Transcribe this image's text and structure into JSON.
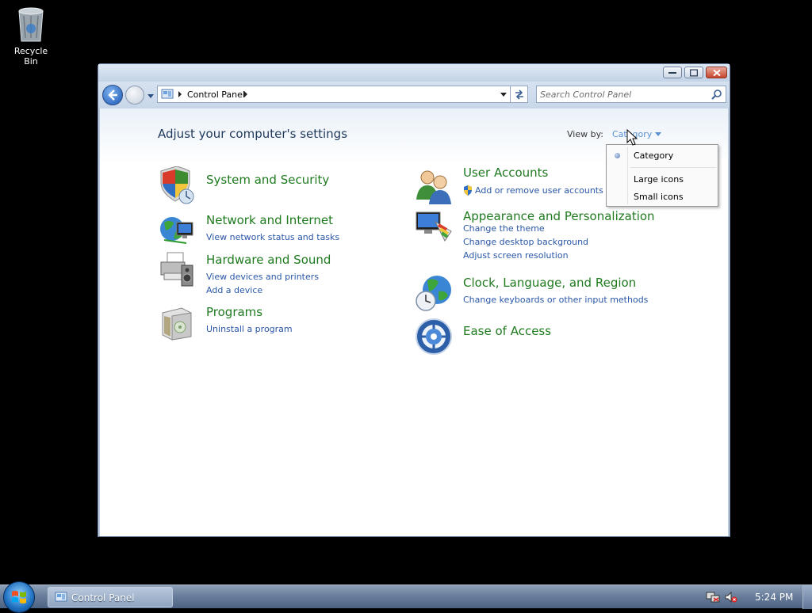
{
  "desktop": {
    "recycle_bin_label": "Recycle Bin"
  },
  "window": {
    "address_path": "Control Panel",
    "search_placeholder": "Search Control Panel"
  },
  "content": {
    "page_title": "Adjust your computer's settings",
    "view_by_label": "View by:",
    "view_by_value": "Category",
    "categories": [
      {
        "title": "System and Security",
        "links": [],
        "icon": "shield-icon"
      },
      {
        "title": "Network and Internet",
        "links": [
          "View network status and tasks"
        ],
        "icon": "network-globe-icon"
      },
      {
        "title": "Hardware and Sound",
        "links": [
          "View devices and printers",
          "Add a device"
        ],
        "icon": "printer-icon"
      },
      {
        "title": "Programs",
        "links": [
          "Uninstall a program"
        ],
        "icon": "programs-box-icon"
      },
      {
        "title": "User Accounts",
        "links": [
          "Add or remove user accounts"
        ],
        "icon": "users-icon"
      },
      {
        "title": "Appearance and Personalization",
        "links": [
          "Change the theme",
          "Change desktop background",
          "Adjust screen resolution"
        ],
        "icon": "monitor-palette-icon"
      },
      {
        "title": "Clock, Language, and Region",
        "links": [
          "Change keyboards or other input methods"
        ],
        "icon": "globe-clock-icon"
      },
      {
        "title": "Ease of Access",
        "links": [],
        "icon": "ease-of-access-icon"
      }
    ]
  },
  "view_menu": {
    "items": [
      "Category",
      "Large icons",
      "Small icons"
    ],
    "selected": "Category"
  },
  "taskbar": {
    "task_label": "Control Panel",
    "clock": "5:24 PM"
  },
  "colors": {
    "category_title": "#1f7a1f",
    "link": "#2a57a8",
    "page_title": "#1e395b"
  }
}
